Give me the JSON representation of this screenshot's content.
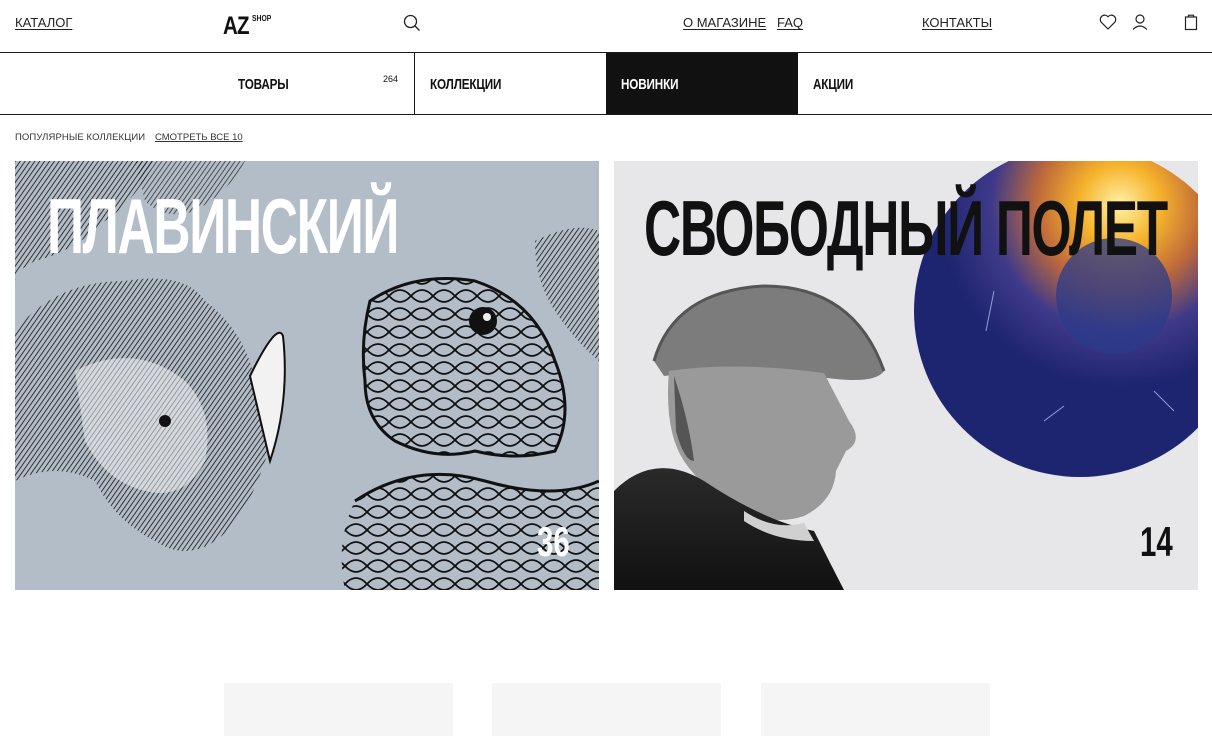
{
  "header": {
    "catalog": "КАТАЛОГ",
    "logo_main": "AZ",
    "logo_sub": "SHOP",
    "about": "О МАГАЗИНЕ",
    "faq": "FAQ",
    "contacts": "КОНТАКТЫ",
    "icons": [
      "search-icon",
      "heart-icon",
      "user-icon",
      "bag-icon"
    ]
  },
  "tabs": [
    {
      "label": "ТОВАРЫ",
      "count": "264"
    },
    {
      "label": "КОЛЛЕКЦИИ"
    },
    {
      "label": "НОВИНКИ",
      "active": true
    },
    {
      "label": "АКЦИИ"
    }
  ],
  "popular": {
    "label": "ПОПУЛЯРНЫЕ КОЛЛЕКЦИИ",
    "see_all": "СМОТРЕТЬ ВСЕ 10"
  },
  "collections": [
    {
      "title": "ПЛАВИНСКИЙ",
      "count": "36"
    },
    {
      "title": "СВОБОДНЫЙ ПОЛЕТ",
      "count": "14"
    }
  ],
  "colors": {
    "active_tab_bg": "#111111",
    "card1_bg": "#b3bdc8",
    "card2_bg": "#e7e7e9"
  }
}
